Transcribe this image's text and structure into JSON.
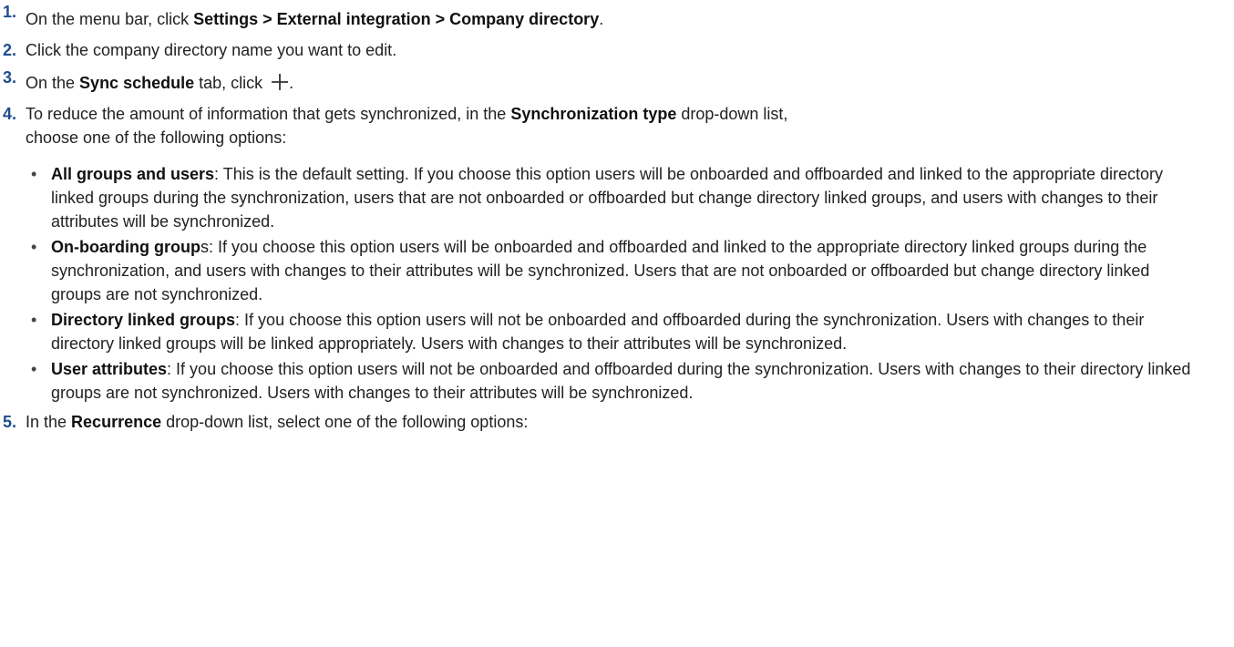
{
  "steps": [
    {
      "num": "1.",
      "pre": "On the menu bar, click ",
      "bold": "Settings > External integration > Company directory",
      "post": "."
    },
    {
      "num": "2.",
      "text": "Click the company directory name you want to edit."
    },
    {
      "num": "3.",
      "pre": "On the ",
      "bold": "Sync schedule",
      "mid": " tab, click ",
      "icon": "plus-icon",
      "post": "."
    },
    {
      "num": "4.",
      "pre": "To reduce the amount of information that gets synchronized, in the ",
      "bold": "Synchronization type",
      "post": " drop-down list,",
      "line2": "choose one of the following options:",
      "options": [
        {
          "bold": "All groups and users",
          "rest": ": This is the default setting. If you choose this option users will be onboarded and offboarded and linked to the appropriate directory linked groups during the synchronization, users that are not onboarded or offboarded but change directory linked groups, and users with changes to their attributes will be synchronized."
        },
        {
          "bold": "On-boarding group",
          "rest": "s: If you choose this option users will be onboarded and offboarded and linked to the appropriate directory linked groups during the synchronization, and users with changes to their attributes will be synchronized. Users that are not onboarded or offboarded but change directory linked groups are not synchronized."
        },
        {
          "bold": "Directory linked groups",
          "rest": ": If you choose this option users will not be onboarded and offboarded during the synchronization. Users with changes to their directory linked groups will be linked appropriately. Users with changes to their attributes will be synchronized."
        },
        {
          "bold": "User attributes",
          "rest": ": If you choose this option users will not be onboarded and offboarded during the synchronization. Users with changes to their directory linked groups are not synchronized. Users with changes to their attributes will be synchronized."
        }
      ]
    },
    {
      "num": "5.",
      "pre": "In the ",
      "bold": "Recurrence",
      "post": " drop-down list, select one of the following options:"
    }
  ],
  "bullet_glyph": "•"
}
